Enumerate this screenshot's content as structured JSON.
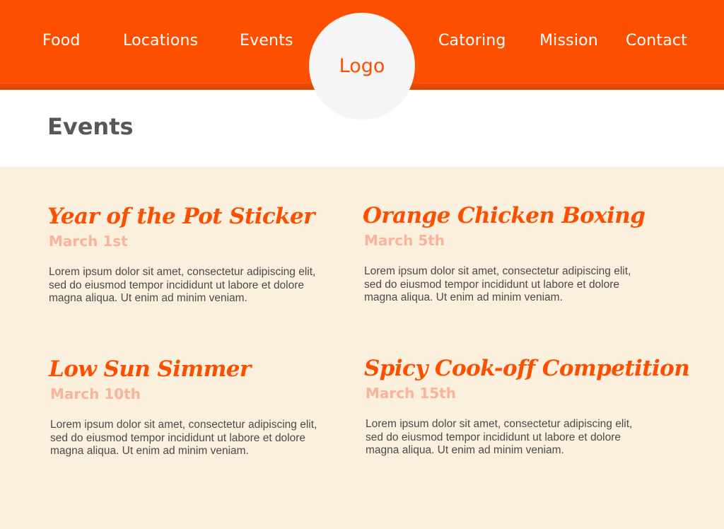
{
  "nav": {
    "left": [
      "Food",
      "Locations",
      "Events"
    ],
    "logo": "Logo",
    "right": [
      "Catoring",
      "Mission",
      "Contact"
    ]
  },
  "page": {
    "title": "Events"
  },
  "events": [
    {
      "title": "Year of the Pot Sticker",
      "date": "March 1st",
      "description": "Lorem ipsum dolor sit amet, consectetur adipiscing elit, sed do eiusmod tempor incididunt ut labore et dolore magna aliqua. Ut enim ad minim veniam."
    },
    {
      "title": "Orange Chicken Boxing",
      "date": "March 5th",
      "description": "Lorem ipsum dolor sit amet, consectetur adipiscing elit, sed do eiusmod tempor incididunt ut labore et dolore magna aliqua. Ut enim ad minim veniam."
    },
    {
      "title": "Low Sun Simmer",
      "date": "March 10th",
      "description": "Lorem ipsum dolor sit amet, consectetur adipiscing elit, sed do eiusmod tempor incididunt ut labore et dolore magna aliqua. Ut enim ad minim veniam."
    },
    {
      "title": "Spicy Cook-off Competition",
      "date": "March 15th",
      "description": "Lorem ipsum dolor sit amet, consectetur adipiscing elit, sed do eiusmod tempor incididunt ut labore et dolore magna aliqua. Ut enim ad minim veniam."
    }
  ],
  "colors": {
    "brand": "#fd4f00",
    "brand_dark": "#e24800",
    "content_background": "#faf0dd",
    "date": "#fbb49b",
    "title": "#575757",
    "body_text": "#4b4b4b",
    "logo_circle": "#f5f5f5"
  }
}
